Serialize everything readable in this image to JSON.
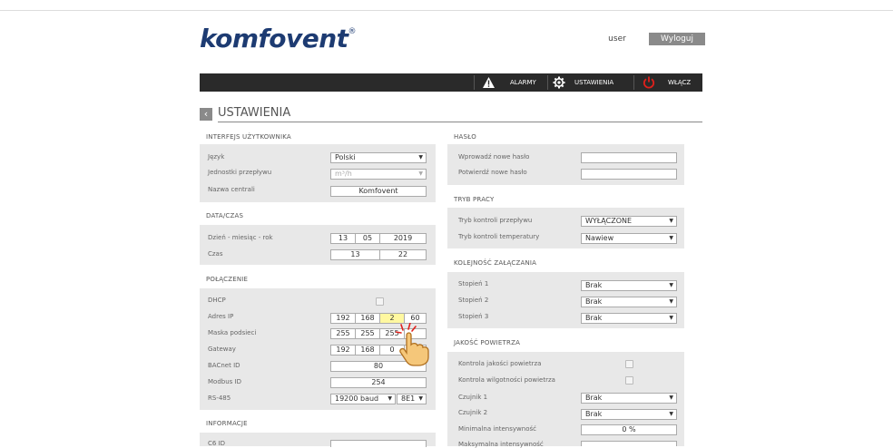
{
  "brand": {
    "logo_text": "komfovent",
    "logo_mark": "®"
  },
  "header": {
    "user_label": "user",
    "logout_label": "Wyloguj"
  },
  "nav": {
    "alarms": "ALARMY",
    "settings": "USTAWIENIA",
    "power": "WŁĄCZ"
  },
  "page": {
    "title": "USTAWIENIA"
  },
  "ui": {
    "title": "INTERFEJS UŻYTKOWNIKA",
    "language_label": "Język",
    "language_value": "Polski",
    "units_label": "Jednostki przepływu",
    "units_value": "m³/h",
    "name_label": "Nazwa centrali",
    "name_value": "Komfovent"
  },
  "datetime": {
    "title": "DATA/CZAS",
    "date_label": "Dzień - miesiąc - rok",
    "day": "13",
    "month": "05",
    "year": "2019",
    "time_label": "Czas",
    "hour": "13",
    "minute": "22"
  },
  "connection": {
    "title": "POŁĄCZENIE",
    "dhcp_label": "DHCP",
    "ip_label": "Adres IP",
    "ip": [
      "192",
      "168",
      "2",
      "60"
    ],
    "mask_label": "Maska podsieci",
    "mask": [
      "255",
      "255",
      "255",
      ""
    ],
    "gateway_label": "Gateway",
    "gateway": [
      "192",
      "168",
      "0",
      ""
    ],
    "bacnet_label": "BACnet ID",
    "bacnet_value": "80",
    "modbus_label": "Modbus ID",
    "modbus_value": "254",
    "rs485_label": "RS-485",
    "rs485_baud": "19200 baud",
    "rs485_format": "8E1"
  },
  "info": {
    "title": "INFORMACJE",
    "c6_label": "C6 ID"
  },
  "password": {
    "title": "HASŁO",
    "new_label": "Wprowadź nowe hasło",
    "confirm_label": "Potwierdź nowe hasło"
  },
  "mode": {
    "title": "TRYB PRACY",
    "flow_label": "Tryb kontroli przepływu",
    "flow_value": "WYŁĄCZONE",
    "temp_label": "Tryb kontroli temperatury",
    "temp_value": "Nawiew"
  },
  "order": {
    "title": "KOLEJNOŚĆ ZAŁĄCZANIA",
    "s1_label": "Stopień 1",
    "s1_value": "Brak",
    "s2_label": "Stopień 2",
    "s2_value": "Brak",
    "s3_label": "Stopień 3",
    "s3_value": "Brak"
  },
  "air": {
    "title": "JAKOŚĆ POWIETRZA",
    "quality_label": "Kontrola jakości powietrza",
    "humidity_label": "Kontrola wilgotności powietrza",
    "sensor1_label": "Czujnik 1",
    "sensor1_value": "Brak",
    "sensor2_label": "Czujnik 2",
    "sensor2_value": "Brak",
    "min_label": "Minimalna intensywność",
    "min_value": "0 %",
    "max_label": "Maksymalna intensywność"
  },
  "colors": {
    "brand": "#1d3b72",
    "navbar": "#2a2a2a",
    "power": "#e0201b",
    "panel": "#e8e8e8"
  }
}
